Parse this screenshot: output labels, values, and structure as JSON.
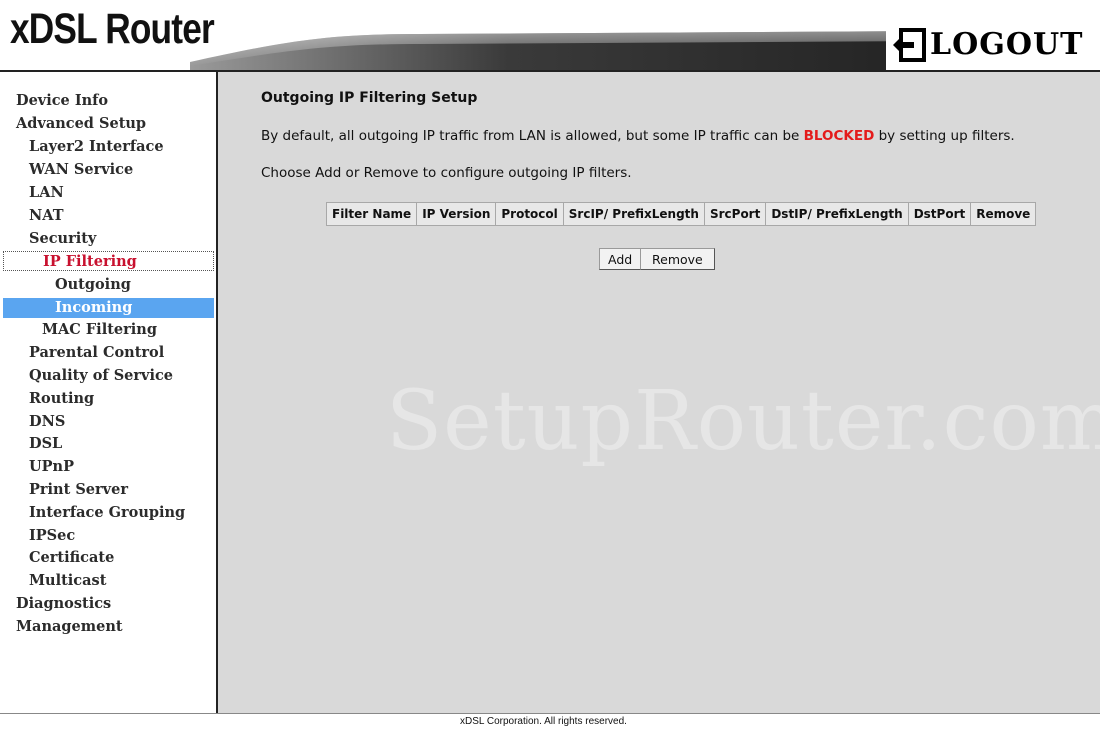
{
  "header": {
    "brand": "xDSL Router",
    "logout_label": "LOGOUT"
  },
  "sidebar": {
    "items": [
      {
        "label": "Device Info",
        "level": 0
      },
      {
        "label": "Advanced Setup",
        "level": 0
      },
      {
        "label": "Layer2 Interface",
        "level": 1
      },
      {
        "label": "WAN Service",
        "level": 1
      },
      {
        "label": "LAN",
        "level": 1
      },
      {
        "label": "NAT",
        "level": 1
      },
      {
        "label": "Security",
        "level": 1
      },
      {
        "label": "IP Filtering",
        "level": 2,
        "state": "current"
      },
      {
        "label": "Outgoing",
        "level": 3
      },
      {
        "label": "Incoming",
        "level": 3,
        "state": "highlight"
      },
      {
        "label": "MAC Filtering",
        "level": 2
      },
      {
        "label": "Parental Control",
        "level": 1
      },
      {
        "label": "Quality of Service",
        "level": 1
      },
      {
        "label": "Routing",
        "level": 1
      },
      {
        "label": "DNS",
        "level": 1
      },
      {
        "label": "DSL",
        "level": 1
      },
      {
        "label": "UPnP",
        "level": 1
      },
      {
        "label": "Print Server",
        "level": 1
      },
      {
        "label": "Interface Grouping",
        "level": 1
      },
      {
        "label": "IPSec",
        "level": 1
      },
      {
        "label": "Certificate",
        "level": 1
      },
      {
        "label": "Multicast",
        "level": 1
      },
      {
        "label": "Diagnostics",
        "level": 0
      },
      {
        "label": "Management",
        "level": 0
      }
    ]
  },
  "main": {
    "title": "Outgoing IP Filtering Setup",
    "description_before": "By default, all outgoing IP traffic from LAN is allowed, but some IP traffic can be ",
    "description_blocked": "BLOCKED",
    "description_after": " by setting up filters.",
    "instruction": "Choose Add or Remove to configure outgoing IP filters.",
    "table_columns": [
      "Filter Name",
      "IP Version",
      "Protocol",
      "SrcIP/ PrefixLength",
      "SrcPort",
      "DstIP/ PrefixLength",
      "DstPort",
      "Remove"
    ],
    "add_button": "Add",
    "remove_button": "Remove",
    "watermark": "SetupRouter.com"
  },
  "footer": {
    "copyright": "xDSL Corporation. All rights reserved."
  },
  "colors": {
    "content_bg": "#d9d9d9",
    "menu_text": "#2b2b2b",
    "menu_current": "#c8102e",
    "menu_highlight_bg": "#5aa5f0",
    "blocked": "#e41b1b"
  }
}
